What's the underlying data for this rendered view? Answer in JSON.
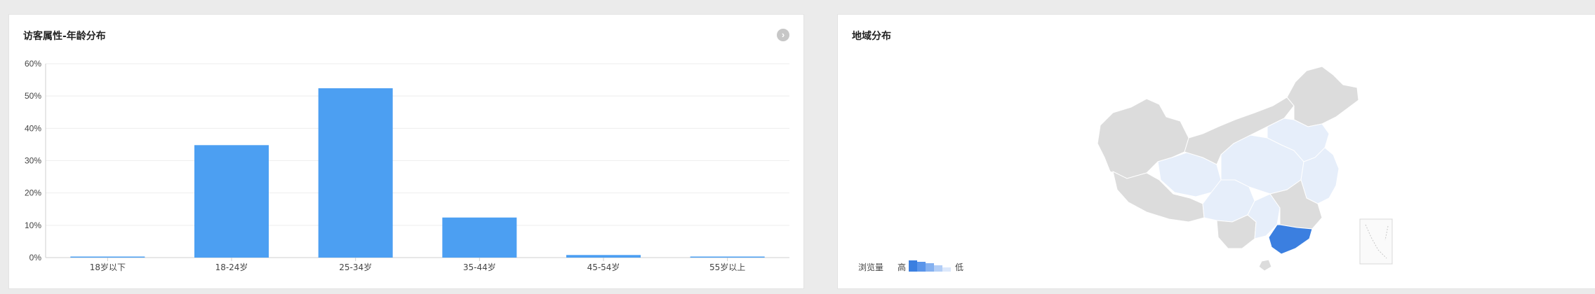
{
  "age_panel": {
    "title": "访客属性-年龄分布"
  },
  "chart_data": {
    "type": "bar",
    "categories": [
      "18岁以下",
      "18-24岁",
      "25-34岁",
      "35-44岁",
      "45-54岁",
      "55岁以上"
    ],
    "values": [
      0.3,
      34.8,
      52.4,
      12.4,
      0.8,
      0.3
    ],
    "yticks": [
      "0%",
      "10%",
      "20%",
      "30%",
      "40%",
      "50%",
      "60%"
    ],
    "ylim": [
      0,
      60
    ],
    "grid": true,
    "color": "#4c9ff2"
  },
  "region_panel": {
    "title": "地域分布",
    "legend": {
      "label": "浏览量",
      "high": "高",
      "low": "低"
    },
    "colors": {
      "highlight": "#3b7fe0",
      "light": "#e6eefa",
      "base": "#dcdcdc",
      "border": "#ffffff"
    }
  }
}
